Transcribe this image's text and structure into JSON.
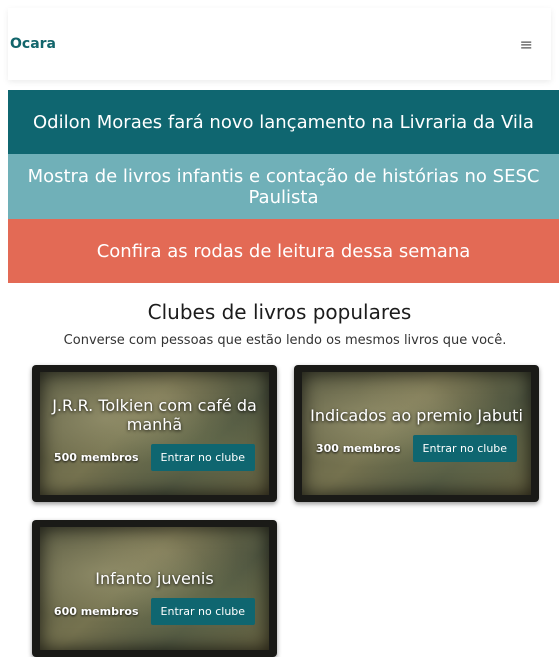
{
  "navbar": {
    "brand": "Ocara",
    "menu_icon": "≡"
  },
  "banners": [
    {
      "text": "Odilon Moraes fará novo lançamento na Livraria da Vila",
      "color": "#0f6670"
    },
    {
      "text": "Mostra de livros infantis e contação de histórias no SESC Paulista",
      "color": "#70b0b8"
    },
    {
      "text": "Confira as rodas de leitura dessa semana",
      "color": "#e36a55"
    }
  ],
  "clubs_section": {
    "title": "Clubes de livros populares",
    "subtitle": "Converse com pessoas que estão lendo os mesmos livros que você.",
    "cards": [
      {
        "title": "J.R.R. Tolkien com café da manhã",
        "members": "500 membros",
        "button": "Entrar no clube"
      },
      {
        "title": "Indicados ao premio Jabuti",
        "members": "300 membros",
        "button": "Entrar no clube"
      },
      {
        "title": "Infanto juvenis",
        "members": "600 membros",
        "button": "Entrar no clube"
      }
    ]
  }
}
